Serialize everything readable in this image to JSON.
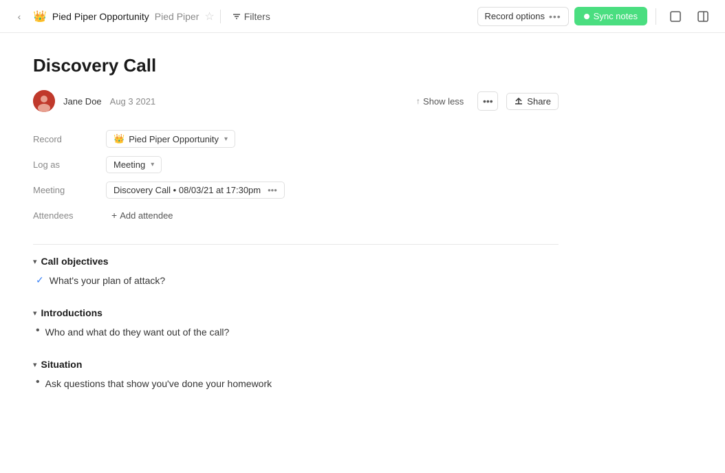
{
  "nav": {
    "back_label": "‹",
    "crown": "👑",
    "breadcrumb_main": "Pied Piper Opportunity",
    "breadcrumb_sub": "Pied Piper",
    "star": "☆",
    "filters_label": "Filters",
    "record_options_label": "Record options",
    "sync_label": "Sync notes"
  },
  "header": {
    "title": "Discovery Call",
    "author": "Jane Doe",
    "date": "Aug 3 2021",
    "show_less": "Show less",
    "share": "Share"
  },
  "fields": {
    "record_label": "Record",
    "record_value": "Pied Piper Opportunity",
    "log_as_label": "Log as",
    "log_as_value": "Meeting",
    "meeting_label": "Meeting",
    "meeting_value": "Discovery Call • 08/03/21 at 17:30pm",
    "attendees_label": "Attendees",
    "add_attendee": "Add attendee"
  },
  "sections": [
    {
      "id": "call-objectives",
      "title": "Call objectives",
      "items": [
        {
          "type": "check",
          "text": "What's your plan of attack?"
        }
      ]
    },
    {
      "id": "introductions",
      "title": "Introductions",
      "items": [
        {
          "type": "bullet",
          "text": "Who and what do they want out of the call?"
        }
      ]
    },
    {
      "id": "situation",
      "title": "Situation",
      "items": [
        {
          "type": "bullet",
          "text": "Ask questions that show you've done your homework"
        }
      ]
    }
  ]
}
